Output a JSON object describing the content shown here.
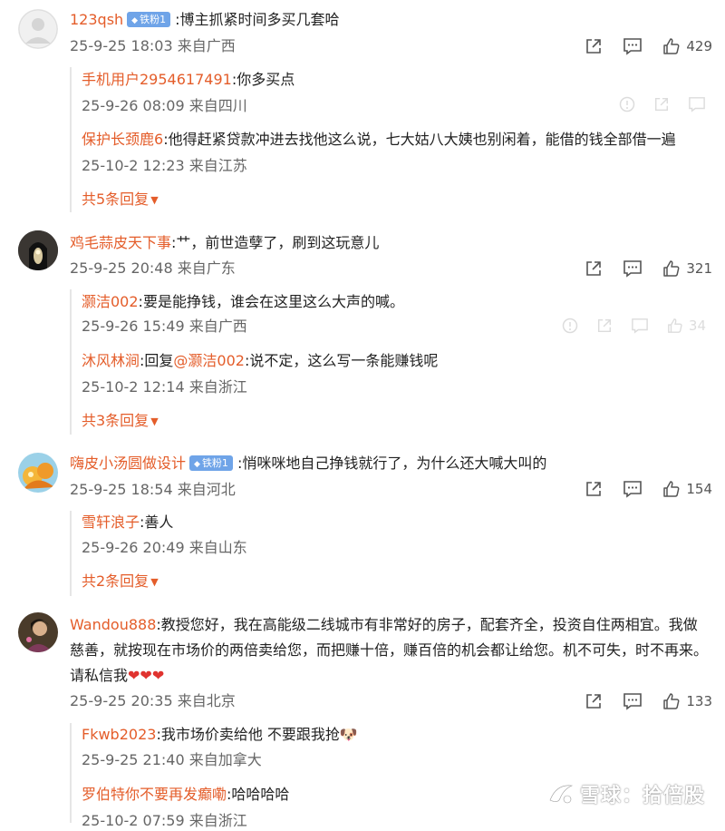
{
  "comments": [
    {
      "user": "123qsh",
      "badge": "铁粉1",
      "text": ":博主抓紧时间多买几套哈",
      "time": "25-9-25 18:03 来自广西",
      "likes": "429",
      "replies": [
        {
          "user": "手机用户2954617491",
          "text": ":你多买点",
          "time": "25-9-26 08:09 来自四川"
        },
        {
          "user": "保护长颈鹿6",
          "text": ":他得赶紧贷款冲进去找他这么说，七大姑八大姨也别闲着，能借的钱全部借一遍",
          "time": "25-10-2 12:23 来自江苏"
        }
      ],
      "more": "共5条回复"
    },
    {
      "user": "鸡毛蒜皮天下事",
      "text": ":艹，前世造孽了，刷到这玩意儿",
      "time": "25-9-25 20:48 来自广东",
      "likes": "321",
      "replies": [
        {
          "user": "灏洁002",
          "text": ":要是能挣钱，谁会在这里这么大声的喊。",
          "time": "25-9-26 15:49 来自广西",
          "ghost_count": "34"
        },
        {
          "user": "沐风林涧",
          "text_prefix": ":回复",
          "mention": "@灏洁002",
          "text": ":说不定，这么写一条能赚钱呢",
          "time": "25-10-2 12:14 来自浙江"
        }
      ],
      "more": "共3条回复"
    },
    {
      "user": "嗨皮小汤圆做设计",
      "badge": "铁粉1",
      "text": ":悄咪咪地自己挣钱就行了，为什么还大喊大叫的",
      "time": "25-9-25 18:54 来自河北",
      "likes": "154",
      "replies": [
        {
          "user": "雪轩浪子",
          "text": ":善人",
          "time": "25-9-26 20:49 来自山东"
        }
      ],
      "more": "共2条回复"
    },
    {
      "user": "Wandou888",
      "text": ":教授您好，我在高能级二线城市有非常好的房子，配套齐全，投资自住两相宜。我做慈善，就按现在市场价的两倍卖给您，而把赚十倍，赚百倍的机会都让给您。机不可失，时不再来。请私信我",
      "emoji": "❤❤❤",
      "time": "25-9-25 20:35 来自北京",
      "likes": "133",
      "replies": [
        {
          "user": "Fkwb2023",
          "text": ":我市场价卖给他 不要跟我抢",
          "emoji": "🐶",
          "time": "25-9-25 21:40 来自加拿大"
        },
        {
          "user": "罗伯特你不要再发癫嘞",
          "text": ":哈哈哈哈",
          "time": "25-10-2 07:59 来自浙江"
        }
      ]
    }
  ],
  "watermark": "雪球：拾倍股",
  "colors": {
    "username": "#e45d2a",
    "badge": "#6fa4e8",
    "meta": "#666666"
  }
}
